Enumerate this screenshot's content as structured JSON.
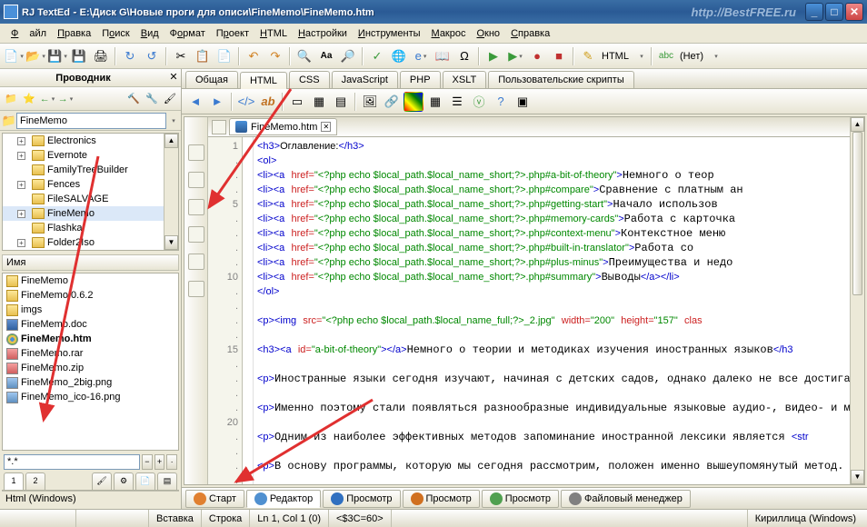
{
  "titlebar": {
    "app": "RJ TextEd",
    "path": "E:\\Диск G\\Новые проги для описи\\FineMemo\\FineMemo.htm",
    "site": "http://BestFREE.ru"
  },
  "menu": {
    "file": "Файл",
    "edit": "Правка",
    "search": "Поиск",
    "view": "Вид",
    "format": "Формат",
    "project": "Проект",
    "html": "HTML",
    "settings": "Настройки",
    "tools": "Инструменты",
    "macros": "Макрос",
    "window": "Окно",
    "help": "Справка"
  },
  "toolbar_right": {
    "lang": "HTML",
    "enc": "(Нет)"
  },
  "sidebar": {
    "title": "Проводник",
    "path": "FineMemo",
    "tree": [
      "Electronics",
      "Evernote",
      "FamilyTreeBuilder",
      "Fences",
      "FileSALVAGE",
      "FineMemo",
      "Flashka",
      "Folder2Iso"
    ],
    "tree_selected": "FineMemo",
    "name_header": "Имя",
    "files": [
      {
        "n": "FineMemo",
        "t": "folder"
      },
      {
        "n": "FineMemo 0.6.2",
        "t": "folder"
      },
      {
        "n": "imgs",
        "t": "folder"
      },
      {
        "n": "FineMemo.doc",
        "t": "doc"
      },
      {
        "n": "FineMemo.htm",
        "t": "chrome",
        "bold": true
      },
      {
        "n": "FineMemo.rar",
        "t": "archive"
      },
      {
        "n": "FineMemo.zip",
        "t": "archive"
      },
      {
        "n": "FineMemo_2big.png",
        "t": "png"
      },
      {
        "n": "FineMemo_ico-16.png",
        "t": "png"
      }
    ],
    "filter": "*.*",
    "foot": "Html (Windows)"
  },
  "lang_tabs": [
    "Общая",
    "HTML",
    "CSS",
    "JavaScript",
    "PHP",
    "XSLT",
    "Пользовательские скрипты"
  ],
  "lang_active": "HTML",
  "doc_tab": "FineMemo.htm",
  "code": {
    "lines_shown": [
      "1",
      ".",
      ".",
      ".",
      "5",
      ".",
      ".",
      ".",
      ".",
      "10",
      ".",
      ".",
      ".",
      ".",
      "15",
      ".",
      ".",
      ".",
      ".",
      "20",
      ".",
      ".",
      ".",
      "."
    ]
  },
  "bottom_tabs": [
    {
      "label": "Старт",
      "active": false
    },
    {
      "label": "Редактор",
      "active": true
    },
    {
      "label": "Просмотр",
      "active": false
    },
    {
      "label": "Просмотр",
      "active": false
    },
    {
      "label": "Просмотр",
      "active": false
    },
    {
      "label": "Файловый менеджер",
      "active": false
    }
  ],
  "status": {
    "insert": "Вставка",
    "line": "Строка",
    "pos": "Ln 1, Col 1 (0)",
    "sel": "<$3C=60>",
    "enc": "Кириллица (Windows)"
  }
}
